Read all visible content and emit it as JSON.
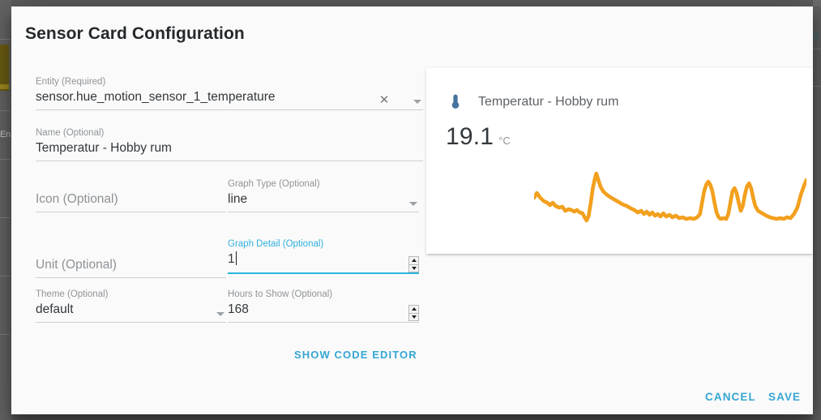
{
  "backdrop": {
    "left_text": "En"
  },
  "dialog": {
    "title": "Sensor Card Configuration"
  },
  "form": {
    "entity": {
      "label": "Entity (Required)",
      "value": "sensor.hue_motion_sensor_1_temperature",
      "clear_icon": "close-icon",
      "dropdown_icon": "chevron-down-icon"
    },
    "name": {
      "label": "Name (Optional)",
      "value": "Temperatur - Hobby rum"
    },
    "icon": {
      "label": "Icon (Optional)",
      "value": ""
    },
    "graph_type": {
      "label": "Graph Type (Optional)",
      "value": "line",
      "dropdown_icon": "chevron-down-icon"
    },
    "unit": {
      "label": "Unit (Optional)",
      "value": ""
    },
    "graph_detail": {
      "label": "Graph Detail (Optional)",
      "value": "1",
      "focused": true,
      "spinner_icon": "number-spinner-icon"
    },
    "theme": {
      "label": "Theme (Optional)",
      "value": "default",
      "dropdown_icon": "chevron-down-icon"
    },
    "hours_to_show": {
      "label": "Hours to Show (Optional)",
      "value": "168",
      "spinner_icon": "number-spinner-icon"
    },
    "show_code_editor": "SHOW CODE EDITOR"
  },
  "preview": {
    "icon": "thermometer-icon",
    "icon_color": "#44739e",
    "title": "Temperatur - Hobby rum",
    "state": "19.1",
    "unit": "°C",
    "chart_color": "#f2a01e"
  },
  "footer": {
    "cancel": "CANCEL",
    "save": "SAVE"
  },
  "chart_data": {
    "type": "line",
    "title": "",
    "xlabel": "",
    "ylabel": "",
    "legend": false,
    "grid": false,
    "series": [
      {
        "name": "Temperatur - Hobby rum",
        "points": [
          [
            0,
            38
          ],
          [
            4,
            32
          ],
          [
            9,
            38
          ],
          [
            14,
            42
          ],
          [
            19,
            44
          ],
          [
            23,
            47
          ],
          [
            27,
            44
          ],
          [
            31,
            48
          ],
          [
            36,
            50
          ],
          [
            41,
            49
          ],
          [
            45,
            54
          ],
          [
            50,
            52
          ],
          [
            54,
            53
          ],
          [
            58,
            55
          ],
          [
            62,
            53
          ],
          [
            66,
            56
          ],
          [
            70,
            57
          ],
          [
            73,
            62
          ],
          [
            76,
            66
          ],
          [
            79,
            60
          ],
          [
            82,
            44
          ],
          [
            85,
            26
          ],
          [
            88,
            14
          ],
          [
            90,
            8
          ],
          [
            93,
            16
          ],
          [
            96,
            24
          ],
          [
            100,
            30
          ],
          [
            105,
            34
          ],
          [
            110,
            37
          ],
          [
            116,
            40
          ],
          [
            122,
            43
          ],
          [
            128,
            46
          ],
          [
            134,
            48
          ],
          [
            140,
            51
          ],
          [
            145,
            53
          ],
          [
            150,
            56
          ],
          [
            155,
            54
          ],
          [
            159,
            58
          ],
          [
            163,
            55
          ],
          [
            167,
            59
          ],
          [
            171,
            56
          ],
          [
            175,
            60
          ],
          [
            179,
            58
          ],
          [
            183,
            61
          ],
          [
            187,
            57
          ],
          [
            191,
            61
          ],
          [
            196,
            59
          ],
          [
            200,
            62
          ],
          [
            205,
            60
          ],
          [
            210,
            63
          ],
          [
            215,
            62
          ],
          [
            220,
            64
          ],
          [
            226,
            63
          ],
          [
            231,
            64
          ],
          [
            236,
            62
          ],
          [
            240,
            58
          ],
          [
            243,
            44
          ],
          [
            246,
            30
          ],
          [
            249,
            22
          ],
          [
            252,
            18
          ],
          [
            255,
            22
          ],
          [
            258,
            30
          ],
          [
            261,
            44
          ],
          [
            264,
            56
          ],
          [
            267,
            62
          ],
          [
            270,
            64
          ],
          [
            274,
            63
          ],
          [
            278,
            64
          ],
          [
            281,
            58
          ],
          [
            284,
            44
          ],
          [
            287,
            30
          ],
          [
            290,
            26
          ],
          [
            293,
            32
          ],
          [
            296,
            44
          ],
          [
            299,
            54
          ],
          [
            302,
            48
          ],
          [
            305,
            34
          ],
          [
            308,
            24
          ],
          [
            311,
            20
          ],
          [
            314,
            26
          ],
          [
            317,
            38
          ],
          [
            320,
            48
          ],
          [
            324,
            54
          ],
          [
            328,
            56
          ],
          [
            332,
            58
          ],
          [
            336,
            60
          ],
          [
            341,
            62
          ],
          [
            346,
            63
          ],
          [
            351,
            64
          ],
          [
            356,
            63
          ],
          [
            361,
            64
          ],
          [
            366,
            62
          ],
          [
            371,
            63
          ],
          [
            376,
            58
          ],
          [
            381,
            50
          ],
          [
            386,
            34
          ],
          [
            391,
            22
          ],
          [
            394,
            16
          ]
        ]
      }
    ],
    "ylim": [
      0,
      92
    ],
    "xlim": [
      0,
      394
    ]
  }
}
